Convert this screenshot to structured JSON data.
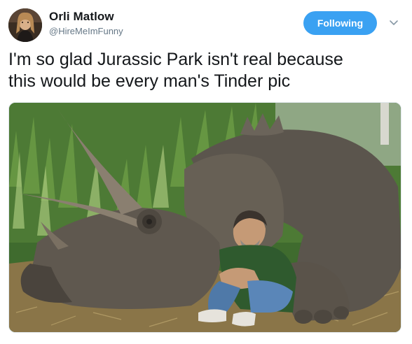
{
  "tweet": {
    "author_name": "Orli Matlow",
    "author_handle": "@HireMeImFunny",
    "follow_label": "Following",
    "text_lines": [
      "I'm so glad Jurassic Park isn't real because",
      "this would be every man's Tinder pic"
    ]
  },
  "icons": {
    "avatar": "profile-photo",
    "menu": "chevron-down-icon"
  },
  "colors": {
    "accent": "#3aa1f2",
    "name": "#14171a",
    "handle": "#657786"
  }
}
